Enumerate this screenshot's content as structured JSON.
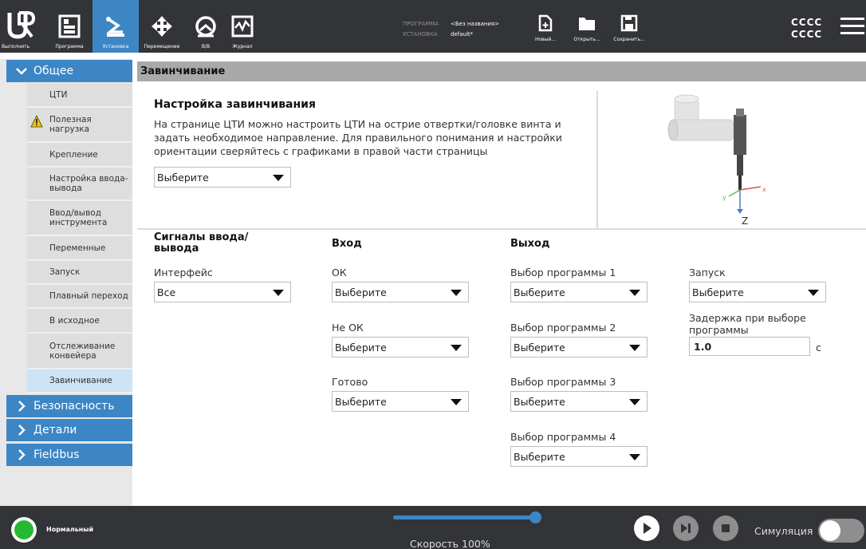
{
  "topbar": {
    "nav": [
      {
        "label": "Выполнить",
        "icon": "run-icon"
      },
      {
        "label": "Программа",
        "icon": "program-icon"
      },
      {
        "label": "Установка",
        "icon": "installation-icon"
      },
      {
        "label": "Перемещение",
        "icon": "move-icon"
      },
      {
        "label": "В/В",
        "icon": "io-icon"
      },
      {
        "label": "Журнал",
        "icon": "log-icon"
      }
    ],
    "program_key": "ПРОГРАММА",
    "program_value": "<Без названия>",
    "installation_key": "УСТАНОВКА",
    "installation_value": "default*",
    "new_label": "Новый...",
    "open_label": "Открыть...",
    "save_label": "Сохранить...",
    "user_line1": "CCCC",
    "user_line2": "CCCC"
  },
  "sidebar": {
    "general": "Общее",
    "items": [
      "ЦТИ",
      "Полезная нагрузка",
      "Крепление",
      "Настройка ввода-вывода",
      "Ввод/вывод инструмента",
      "Переменные",
      "Запуск",
      "Плавный переход",
      "В исходное",
      "Отслеживание конвейера",
      "Завинчивание"
    ],
    "safety": "Безопасность",
    "details": "Детали",
    "fieldbus": "Fieldbus"
  },
  "main": {
    "header": "Завинчивание",
    "setup_title": "Настройка завинчивания",
    "setup_desc": "На странице ЦТИ можно настроить ЦТИ на острие отвертки/головке винта и задать необходимое направление. Для правильного понимания и настройки ориентации сверяйтесь с графиками в правой части страницы",
    "setup_select": "Выберите",
    "signals_title": "Сигналы ввода/вывода",
    "input_title": "Вход",
    "output_title": "Выход",
    "interface_label": "Интерфейс",
    "interface_value": "Все",
    "ok_label": "ОК",
    "notok_label": "Не ОК",
    "ready_label": "Готово",
    "prog1_label": "Выбор программы 1",
    "prog2_label": "Выбор программы 2",
    "prog3_label": "Выбор программы 3",
    "prog4_label": "Выбор программы 4",
    "start_label": "Запуск",
    "delay_label": "Задержка при выборе программы",
    "delay_value": "1.0",
    "delay_unit": "с",
    "select": "Выберите",
    "axis_x": "x",
    "axis_y": "y",
    "axis_z": "Z"
  },
  "bottom": {
    "status": "Нормальный",
    "speed_text": "Скорость 100%",
    "speed_fraction": 1.0,
    "sim_label": "Симуляция"
  },
  "colors": {
    "accent": "#3c86c6",
    "bar": "#333438",
    "status_ok": "#27b832"
  }
}
